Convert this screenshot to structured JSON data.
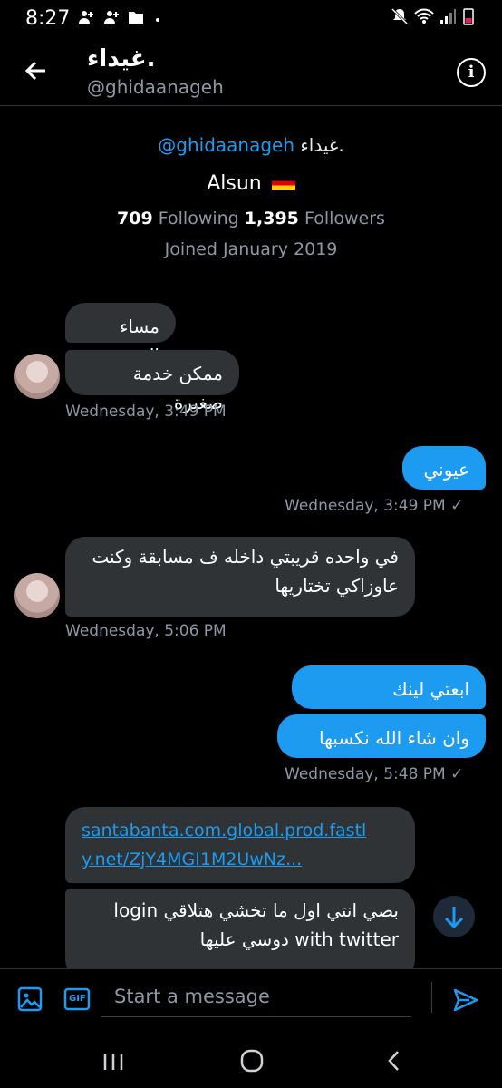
{
  "status_bar": {
    "time": "8:27",
    "left_icons": [
      "add-person-icon",
      "add-person-icon",
      "folder-icon",
      "dot-icon"
    ],
    "right_icons": [
      "mute-icon",
      "wifi-icon",
      "signal-icon",
      "battery-icon"
    ]
  },
  "header": {
    "name": "غيداء.",
    "handle": "@ghidaanageh",
    "info_label": "i"
  },
  "profile": {
    "name": "غيداء.",
    "handle": "@ghidaanageh",
    "bio": "Alsun",
    "following_count": "709",
    "following_label": "Following",
    "followers_count": "1,395",
    "followers_label": "Followers",
    "joined": "Joined January 2019"
  },
  "messages": [
    {
      "dir": "in",
      "text": "مساء الخير"
    },
    {
      "dir": "in",
      "text": "ممكن خدمة صغيرة"
    },
    {
      "dir": "meta-in",
      "text": "Wednesday, 3:49 PM"
    },
    {
      "dir": "out",
      "text": "عيوني"
    },
    {
      "dir": "meta-out",
      "text": "Wednesday, 3:49 PM"
    },
    {
      "dir": "in",
      "line1": "في واحده قريبتي داخله ف مسابقة وكنت",
      "line2": "عاوزاكي تختاريها"
    },
    {
      "dir": "meta-in",
      "text": "Wednesday, 5:06 PM"
    },
    {
      "dir": "out",
      "text": "ابعتي لينك"
    },
    {
      "dir": "out",
      "text": "وان شاء الله نكسبها"
    },
    {
      "dir": "meta-out",
      "text": "Wednesday, 5:48 PM"
    },
    {
      "dir": "in-link",
      "line1": "santabanta.com.global.prod.fastl",
      "line2": "y.net/ZjY4MGI1M2UwNz..."
    },
    {
      "dir": "in",
      "line1": "بصي انتي اول ما تخشي هتلاقي login",
      "line2": "with twitter دوسي عليها"
    }
  ],
  "read_check": "✓",
  "composer": {
    "placeholder": "Start a message",
    "gif_label": "GIF"
  },
  "colors": {
    "accent": "#1d9bf0",
    "incoming_bubble": "#2f3336",
    "background": "#000000",
    "muted_text": "#8b98a5"
  }
}
